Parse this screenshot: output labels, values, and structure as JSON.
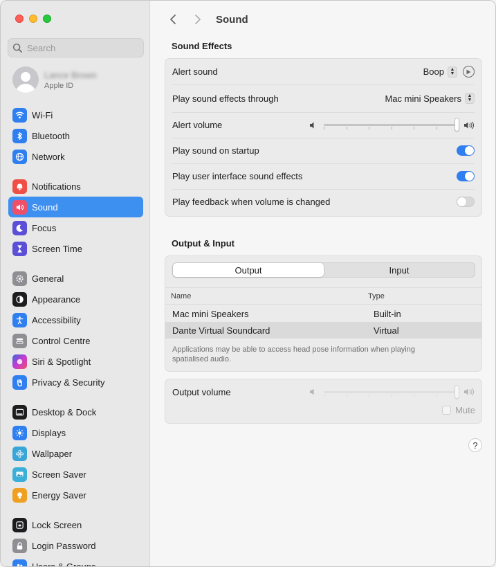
{
  "window": {
    "title": "Sound"
  },
  "search": {
    "placeholder": "Search"
  },
  "account": {
    "name": "Lance Brown",
    "subtitle": "Apple ID"
  },
  "sidebar": {
    "groups": [
      [
        {
          "label": "Wi-Fi",
          "icon": "wifi-icon",
          "color": "#2f7ff0"
        },
        {
          "label": "Bluetooth",
          "icon": "bluetooth-icon",
          "color": "#2f7ff0"
        },
        {
          "label": "Network",
          "icon": "globe-icon",
          "color": "#2f7ff0"
        }
      ],
      [
        {
          "label": "Notifications",
          "icon": "bell-icon",
          "color": "#f04f45"
        },
        {
          "label": "Sound",
          "icon": "speaker-icon",
          "color": "#f04f6a",
          "selected": true
        },
        {
          "label": "Focus",
          "icon": "moon-icon",
          "color": "#5a4fd6"
        },
        {
          "label": "Screen Time",
          "icon": "hourglass-icon",
          "color": "#5a4fd6"
        }
      ],
      [
        {
          "label": "General",
          "icon": "gear-icon",
          "color": "#8e8e93"
        },
        {
          "label": "Appearance",
          "icon": "appearance-icon",
          "color": "#1d1d1f"
        },
        {
          "label": "Accessibility",
          "icon": "accessibility-icon",
          "color": "#2f7ff0"
        },
        {
          "label": "Control Centre",
          "icon": "control-centre-icon",
          "color": "#8e8e93"
        },
        {
          "label": "Siri & Spotlight",
          "icon": "siri-icon",
          "color": "#a83ad6"
        },
        {
          "label": "Privacy & Security",
          "icon": "hand-icon",
          "color": "#2f7ff0"
        }
      ],
      [
        {
          "label": "Desktop & Dock",
          "icon": "dock-icon",
          "color": "#1d1d1f"
        },
        {
          "label": "Displays",
          "icon": "sun-icon",
          "color": "#2f7ff0"
        },
        {
          "label": "Wallpaper",
          "icon": "flower-icon",
          "color": "#3aa6d8"
        },
        {
          "label": "Screen Saver",
          "icon": "screen-saver-icon",
          "color": "#3ab0d8"
        },
        {
          "label": "Energy Saver",
          "icon": "bulb-icon",
          "color": "#f0a020"
        }
      ],
      [
        {
          "label": "Lock Screen",
          "icon": "lock-screen-icon",
          "color": "#1d1d1f"
        },
        {
          "label": "Login Password",
          "icon": "lock-icon",
          "color": "#8e8e93"
        },
        {
          "label": "Users & Groups",
          "icon": "users-icon",
          "color": "#2f7ff0"
        }
      ]
    ]
  },
  "sound_effects": {
    "title": "Sound Effects",
    "alert_sound_label": "Alert sound",
    "alert_sound_value": "Boop",
    "play_through_label": "Play sound effects through",
    "play_through_value": "Mac mini Speakers",
    "alert_volume_label": "Alert volume",
    "alert_volume_level": 1.0,
    "startup_label": "Play sound on startup",
    "startup_on": true,
    "ui_effects_label": "Play user interface sound effects",
    "ui_effects_on": true,
    "feedback_label": "Play feedback when volume is changed",
    "feedback_on": false
  },
  "output_input": {
    "title": "Output & Input",
    "tabs": [
      "Output",
      "Input"
    ],
    "active_tab": "Output",
    "columns": [
      "Name",
      "Type"
    ],
    "devices": [
      {
        "name": "Mac mini Speakers",
        "type": "Built-in"
      },
      {
        "name": "Dante Virtual Soundcard",
        "type": "Virtual",
        "selected": true
      }
    ],
    "note": "Applications may be able to access head pose information when playing spatialised audio."
  },
  "output_volume": {
    "label": "Output volume",
    "level": 1.0,
    "mute_label": "Mute",
    "muted": false
  },
  "help": {
    "label": "?"
  }
}
